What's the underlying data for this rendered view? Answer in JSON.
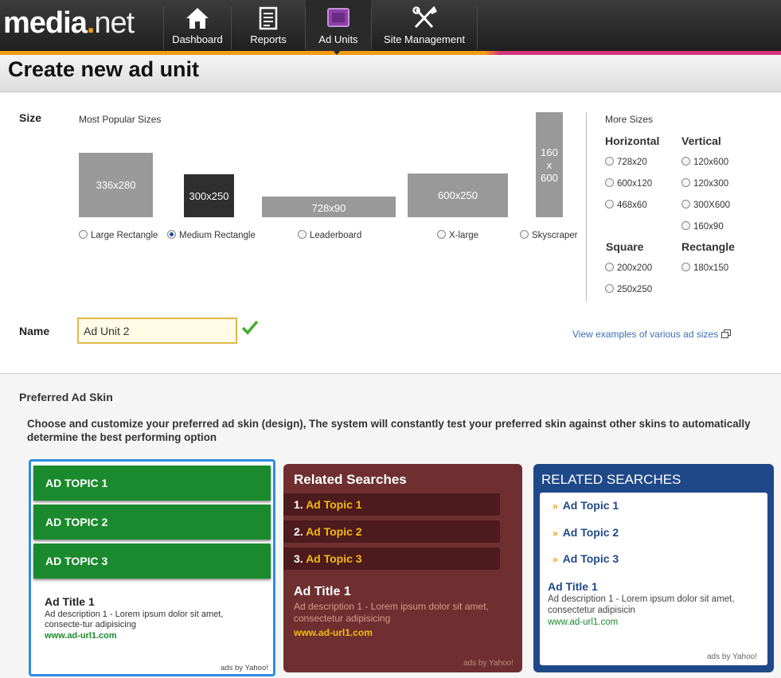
{
  "header": {
    "logo_main": "media",
    "logo_dot": ".",
    "logo_net": "net",
    "nav": [
      {
        "label": "Dashboard",
        "icon": "home-icon"
      },
      {
        "label": "Reports",
        "icon": "document-icon"
      },
      {
        "label": "Ad Units",
        "icon": "monitor-icon",
        "active": true
      },
      {
        "label": "Site Management",
        "icon": "tools-icon"
      }
    ]
  },
  "page_title": "Create new ad unit",
  "size": {
    "label": "Size",
    "popular_label": "Most Popular Sizes",
    "popular": [
      {
        "box": "336x280",
        "label": "Large Rectangle",
        "selected": false
      },
      {
        "box": "300x250",
        "label": "Medium Rectangle",
        "selected": true
      },
      {
        "box": "728x90",
        "label": "Leaderboard",
        "selected": false
      },
      {
        "box": "600x250",
        "label": "X-large",
        "selected": false
      },
      {
        "box_lines": [
          "160",
          "x",
          "600"
        ],
        "label": "Skyscraper",
        "selected": false
      }
    ],
    "more_label": "More Sizes",
    "groups": {
      "horizontal": {
        "title": "Horizontal",
        "options": [
          "728x20",
          "600x120",
          "468x60"
        ]
      },
      "vertical": {
        "title": "Vertical",
        "options": [
          "120x600",
          "120x300",
          "300X600",
          "160x90"
        ]
      },
      "square": {
        "title": "Square",
        "options": [
          "200x200",
          "250x250"
        ]
      },
      "rectangle": {
        "title": "Rectangle",
        "options": [
          "180x150"
        ]
      }
    }
  },
  "name": {
    "label": "Name",
    "value": "Ad Unit 2",
    "examples_link": "View examples of various ad sizes"
  },
  "skin": {
    "label": "Preferred Ad Skin",
    "description": "Choose and customize your preferred ad skin (design), The system will constantly test your preferred skin against other skins to automatically determine the best performing option",
    "green": {
      "topics": [
        "AD TOPIC 1",
        "AD TOPIC 2",
        "AD TOPIC 3"
      ],
      "ad_title": "Ad Title 1",
      "ad_desc": "Ad description 1 - Lorem ipsum dolor sit amet, consecte-tur adipisicing",
      "ad_url": "www.ad-url1.com",
      "credit": "ads by Yahoo!"
    },
    "maroon": {
      "heading": "Related Searches",
      "topics": [
        {
          "num": "1.",
          "text": "Ad Topic 1"
        },
        {
          "num": "2.",
          "text": "Ad Topic 2"
        },
        {
          "num": "3.",
          "text": "Ad Topic 3"
        }
      ],
      "ad_title": "Ad Title 1",
      "ad_desc": "Ad description 1 - Lorem ipsum dolor sit amet, consectetur adipisicing",
      "ad_url": "www.ad-url1.com",
      "credit": "ads by Yahoo!"
    },
    "blue": {
      "heading": "RELATED SEARCHES",
      "topics": [
        "Ad Topic 1",
        "Ad Topic 2",
        "Ad Topic 3"
      ],
      "ad_title": "Ad Title 1",
      "ad_desc": "Ad description 1 - Lorem ipsum dolor sit amet, consectetur adipisicin",
      "ad_url": "www.ad-url1.com",
      "credit": "ads by Yahoo!"
    }
  },
  "colors": {
    "accent_orange": "#f39c12",
    "accent_pink": "#d4367e",
    "green_skin": "#1b8a2e",
    "maroon_skin": "#6f2f30",
    "blue_skin": "#1f4888",
    "selected_border": "#2b8ee0"
  }
}
